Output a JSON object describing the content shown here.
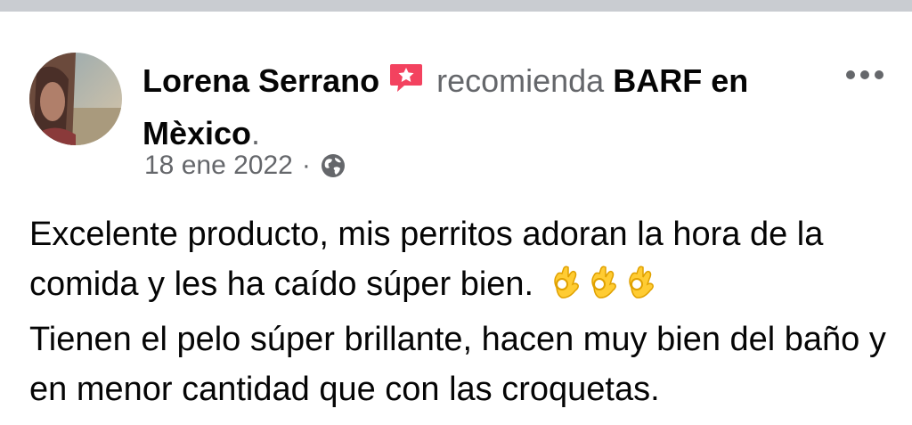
{
  "post": {
    "author": "Lorena Serrano",
    "verb": "recomienda",
    "page": "BARF en Mèxico",
    "period": ".",
    "date": "18 ene 2022",
    "separator": "·",
    "body_line_1": "Excelente producto, mis perritos adoran la hora de la comida y les ha caído súper bien.",
    "body_line_2": "Tienen el pelo súper brillante, hacen muy bien del baño y en menor cantidad que con las croquetas.",
    "emoji": "ok-hand-emoji",
    "emoji_count": 3
  },
  "icons": {
    "recommendation_badge": "recommendation-badge-icon",
    "privacy": "globe-icon",
    "more": "more-options-icon"
  },
  "colors": {
    "primary_text": "#050505",
    "secondary_text": "#65676b",
    "badge_red": "#f3425f",
    "top_strip": "#c9ccd1"
  }
}
